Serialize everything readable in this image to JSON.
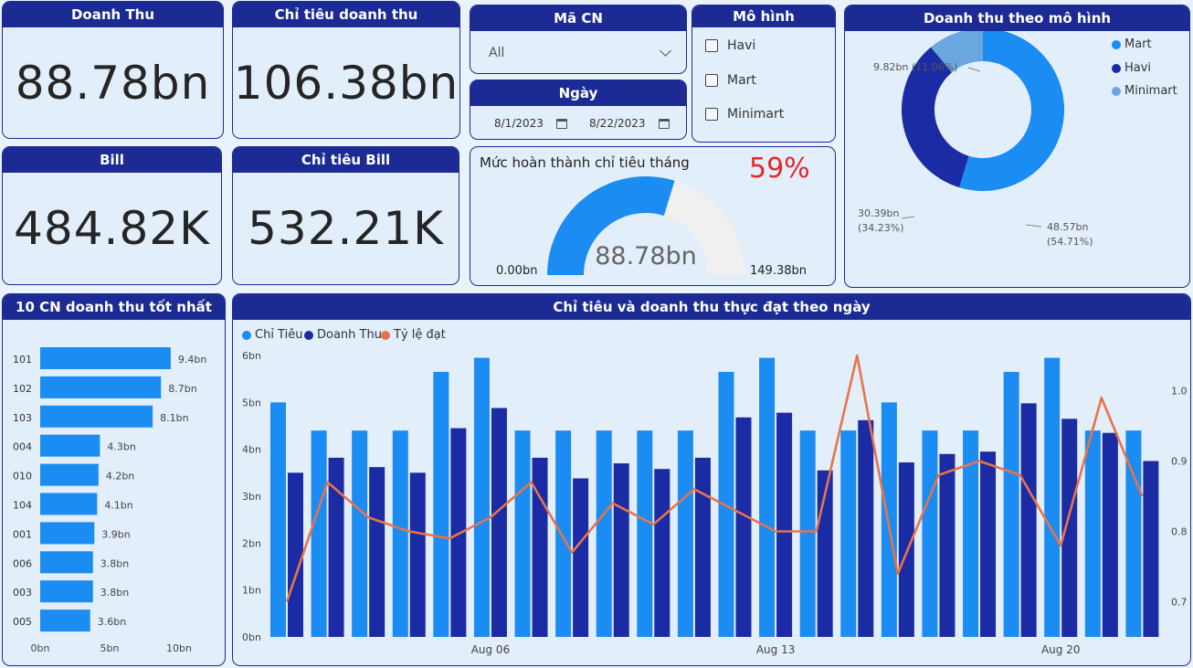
{
  "kpis": {
    "revenue": {
      "title": "Doanh Thu",
      "value": "88.78bn"
    },
    "revenue_target": {
      "title": "Chỉ tiêu doanh thu",
      "value": "106.38bn"
    },
    "bill": {
      "title": "Bill",
      "value": "484.82K"
    },
    "bill_target": {
      "title": "Chỉ tiêu Bill",
      "value": "532.21K"
    }
  },
  "filters": {
    "branch": {
      "title": "Mã CN",
      "value": "All"
    },
    "date": {
      "title": "Ngày",
      "from": "8/1/2023",
      "to": "8/22/2023"
    },
    "model": {
      "title": "Mô hình",
      "options": [
        "Havi",
        "Mart",
        "Minimart"
      ]
    }
  },
  "gauge": {
    "title": "Mức hoàn thành chỉ tiêu tháng",
    "percent_label": "59%",
    "value": 88.78,
    "value_label": "88.78bn",
    "min_label": "0.00bn",
    "max_label": "149.38bn",
    "max": 149.38
  },
  "colors": {
    "header": "#1c2b94",
    "target": "#1a8cf2",
    "revenue": "#1a2ba3",
    "rate": "#e8734a",
    "mart": "#1a8cf2",
    "havi": "#1a2ba3",
    "minimart": "#6aa6e0",
    "gauge_track": "#f0f0f0",
    "percent": "#e6262a"
  },
  "chart_data": [
    {
      "type": "pie",
      "title": "Doanh thu theo mô hình",
      "categories": [
        "Mart",
        "Havi",
        "Minimart"
      ],
      "values": [
        48.57,
        30.39,
        9.82
      ],
      "value_labels": [
        "48.57bn",
        "30.39bn",
        "9.82bn"
      ],
      "percent_labels": [
        "(54.71%)",
        "(34.23%)",
        "(11.06%)"
      ],
      "legend": "top-right"
    },
    {
      "type": "bar",
      "title": "10 CN doanh thu tốt nhất",
      "categories": [
        "101",
        "102",
        "103",
        "004",
        "010",
        "104",
        "001",
        "006",
        "003",
        "005"
      ],
      "values": [
        9.4,
        8.7,
        8.1,
        4.3,
        4.2,
        4.1,
        3.9,
        3.8,
        3.8,
        3.6
      ],
      "value_labels": [
        "9.4bn",
        "8.7bn",
        "8.1bn",
        "4.3bn",
        "4.2bn",
        "4.1bn",
        "3.9bn",
        "3.8bn",
        "3.8bn",
        "3.6bn"
      ],
      "xlim": [
        0,
        10
      ],
      "x_ticks": [
        "0bn",
        "5bn",
        "10bn"
      ]
    },
    {
      "type": "bar",
      "title": "Chỉ tiêu và doanh thu thực đạt theo ngày",
      "x": [
        "2023-08-01",
        "2023-08-02",
        "2023-08-03",
        "2023-08-04",
        "2023-08-05",
        "2023-08-06",
        "2023-08-07",
        "2023-08-08",
        "2023-08-09",
        "2023-08-10",
        "2023-08-11",
        "2023-08-12",
        "2023-08-13",
        "2023-08-14",
        "2023-08-15",
        "2023-08-16",
        "2023-08-17",
        "2023-08-18",
        "2023-08-19",
        "2023-08-20",
        "2023-08-21",
        "2023-08-22"
      ],
      "x_ticks": [
        "Aug 06",
        "Aug 13",
        "Aug 20"
      ],
      "series": [
        {
          "name": "Chỉ Tiêu",
          "type": "bar",
          "values": [
            5.0,
            4.4,
            4.4,
            4.4,
            5.65,
            5.95,
            4.4,
            4.4,
            4.4,
            4.4,
            4.4,
            5.65,
            5.95,
            4.4,
            4.4,
            5.0,
            4.4,
            4.4,
            5.65,
            5.95,
            4.4,
            4.4
          ]
        },
        {
          "name": "Doanh Thu",
          "type": "bar",
          "values": [
            3.5,
            3.82,
            3.62,
            3.5,
            4.45,
            4.88,
            3.82,
            3.38,
            3.7,
            3.58,
            3.82,
            4.68,
            4.78,
            3.55,
            4.62,
            3.72,
            3.9,
            3.95,
            4.98,
            4.65,
            4.35,
            3.75
          ]
        },
        {
          "name": "Tỷ lệ đạt",
          "type": "line",
          "axis": "right",
          "values": [
            0.7,
            0.87,
            0.82,
            0.8,
            0.79,
            0.82,
            0.87,
            0.77,
            0.84,
            0.81,
            0.86,
            0.83,
            0.8,
            0.8,
            1.05,
            0.74,
            0.88,
            0.9,
            0.88,
            0.78,
            0.99,
            0.85
          ]
        }
      ],
      "ylim": [
        0,
        6
      ],
      "y_ticks": [
        "0bn",
        "1bn",
        "2bn",
        "3bn",
        "4bn",
        "5bn",
        "6bn"
      ],
      "y2lim": [
        0.65,
        1.05
      ],
      "y2_ticks": [
        "0.7",
        "0.8",
        "0.9",
        "1.0"
      ],
      "legend": "top-left"
    }
  ]
}
